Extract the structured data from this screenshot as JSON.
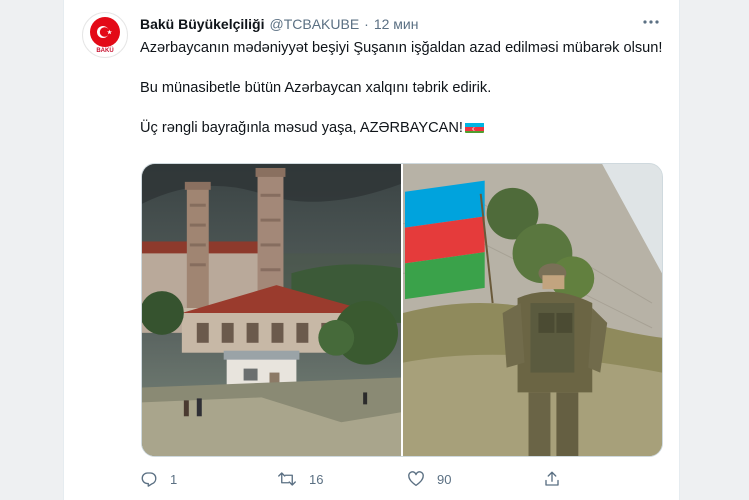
{
  "tweet": {
    "author_name": "Bakü Büyükelçiliği",
    "handle": "@TCBAKUBE",
    "separator": "·",
    "time": "12 мин",
    "avatar_caption": "BAKÜ",
    "paragraphs": [
      "Azərbaycanın mədəniyyət beşiyi Şuşanın işğaldan azad edilməsi mübarək olsun!",
      "Bu münasibetle bütün Azərbaycan xalqını təbrik edirik.",
      "Üç rəngli bayrağınla məsud yaşa, AZƏRBAYCAN!"
    ],
    "flag_emoji": "azerbaijan-flag-emoji",
    "stats": {
      "replies": "1",
      "retweets": "16",
      "likes": "90"
    }
  },
  "media": [
    {
      "description_icon": "mosque-photo"
    },
    {
      "description_icon": "soldier-with-flag-photo"
    }
  ],
  "colors": {
    "secondary_text": "#5b7083",
    "flag_blue": "#3f9c35",
    "flag_red": "#ed2939",
    "flag_green": "#509e2f"
  }
}
